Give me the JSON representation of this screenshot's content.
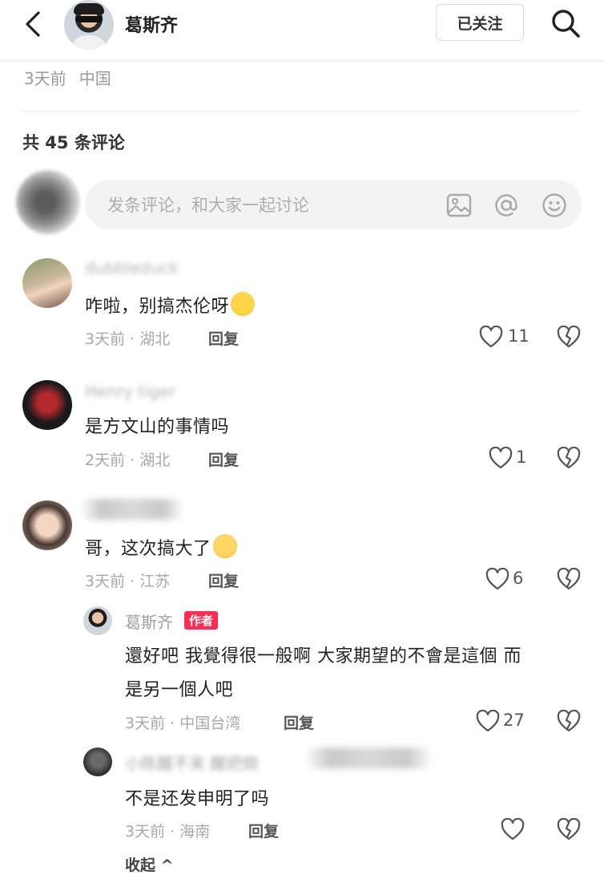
{
  "header": {
    "user_name": "葛斯齐",
    "follow_label": "已关注"
  },
  "post_meta": {
    "time": "3天前",
    "location": "中国"
  },
  "comments_count": "共 45 条评论",
  "input": {
    "placeholder": "发条评论，和大家一起讨论"
  },
  "comments": [
    {
      "name": "dubbleduck",
      "text": "咋啦，别搞杰伦呀",
      "meta": "3天前 · 湖北",
      "reply_label": "回复",
      "likes": "11"
    },
    {
      "name": "Henry tiger",
      "text": "是方文山的事情吗",
      "meta": "2天前 · 湖北",
      "reply_label": "回复",
      "likes": "1"
    },
    {
      "name": "",
      "text": "哥，这次搞大了",
      "meta": "3天前 · 江苏",
      "reply_label": "回复",
      "likes": "6"
    }
  ],
  "replies": [
    {
      "name": "葛斯齐",
      "badge": "作者",
      "text_line1": "還好吧 我覺得很一般啊 大家期望的不會是這個 而",
      "text_line2": "是另一個人吧",
      "meta": "3天前 · 中国台湾",
      "reply_label": "回复",
      "likes": "27"
    },
    {
      "name": "小陈醒不来 醒把倒",
      "text": "不是还发申明了吗",
      "meta": "3天前 · 海南",
      "reply_label": "回复",
      "likes": ""
    }
  ],
  "collapse_label": "收起",
  "colors": {
    "badge": "#fe2c55",
    "meta_gray": "#a8a8a8"
  }
}
